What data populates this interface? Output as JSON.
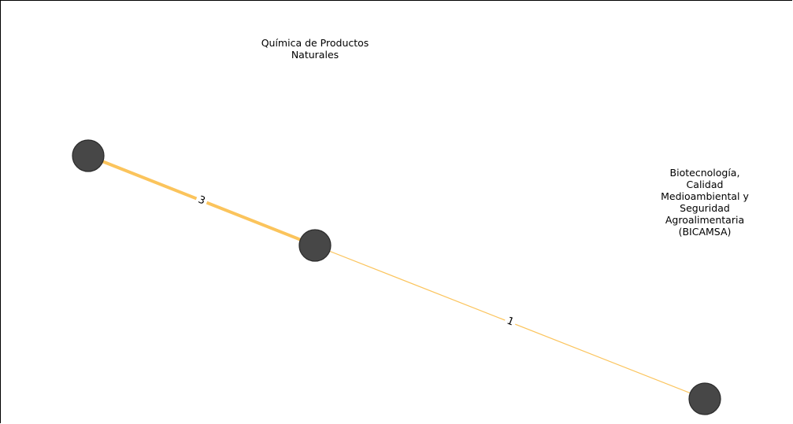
{
  "nodes": [
    {
      "id": "n1",
      "label": ""
    },
    {
      "id": "n2",
      "label": "Química de Productos\nNaturales"
    },
    {
      "id": "n3",
      "label": "Biotecnología,\nCalidad\nMedioambiental y\nSeguridad\nAgroalimentaria\n(BICAMSA)"
    }
  ],
  "edges": [
    {
      "source": "n1",
      "target": "n2",
      "weight": "3"
    },
    {
      "source": "n2",
      "target": "n3",
      "weight": "1"
    }
  ],
  "colors": {
    "node_fill": "#474747",
    "node_stroke": "#2b2b2b",
    "edge": "#fbc45c"
  }
}
